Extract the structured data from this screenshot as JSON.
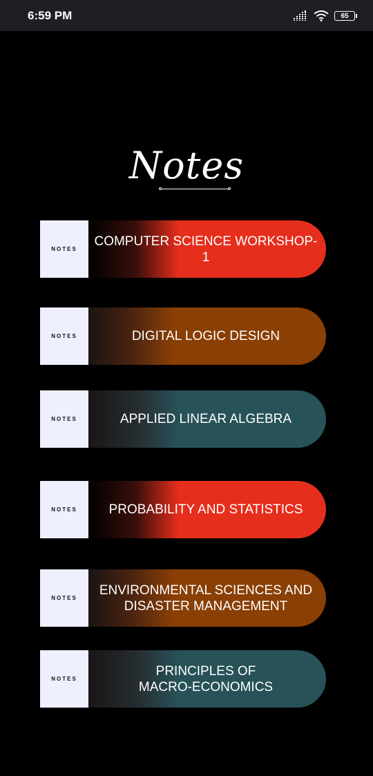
{
  "status_bar": {
    "time": "6:59 PM",
    "battery": "65",
    "icons": [
      "signal-icon",
      "wifi-icon",
      "battery-icon"
    ]
  },
  "page": {
    "title": "Notes"
  },
  "colors": {
    "background": "#000000",
    "tag_background": "#eef0ff",
    "red": "#e62e1c",
    "brown": "#8a3f04",
    "teal": "#275258"
  },
  "notes": [
    {
      "tag": "NOTES",
      "title": "COMPUTER SCIENCE WORKSHOP-1",
      "color": "red"
    },
    {
      "tag": "NOTES",
      "title": "DIGITAL LOGIC DESIGN",
      "color": "brown"
    },
    {
      "tag": "NOTES",
      "title": "APPLIED LINEAR ALGEBRA",
      "color": "teal"
    },
    {
      "tag": "NOTES",
      "title": "PROBABILITY AND STATISTICS",
      "color": "red"
    },
    {
      "tag": "NOTES",
      "title": "ENVIRONMENTAL SCIENCES AND\nDISASTER MANAGEMENT",
      "color": "brown"
    },
    {
      "tag": "NOTES",
      "title": "PRINCIPLES OF\nMACRO-ECONOMICS",
      "color": "teal"
    }
  ]
}
